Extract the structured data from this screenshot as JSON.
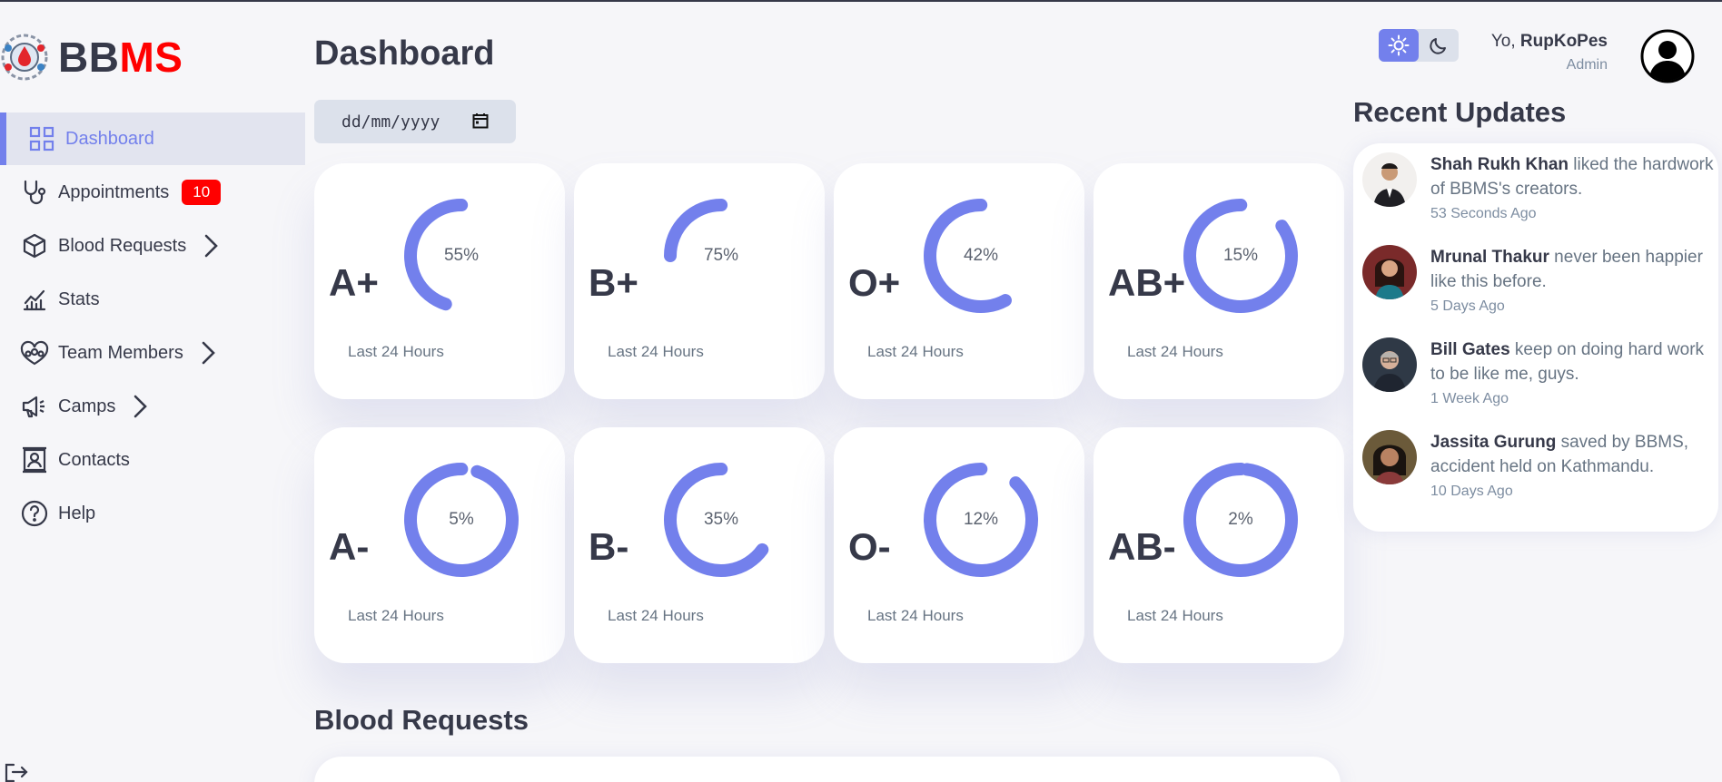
{
  "brand": {
    "part1": "BB",
    "part2": "MS"
  },
  "sidebar": {
    "items": [
      {
        "label": "Dashboard",
        "icon": "grid-icon"
      },
      {
        "label": "Appointments",
        "icon": "stethoscope-icon",
        "badge": "10"
      },
      {
        "label": "Blood Requests",
        "icon": "cube-icon",
        "chevron": true
      },
      {
        "label": "Stats",
        "icon": "chart-icon"
      },
      {
        "label": "Team Members",
        "icon": "team-icon",
        "chevron": true
      },
      {
        "label": "Camps",
        "icon": "megaphone-icon",
        "chevron": true
      },
      {
        "label": "Contacts",
        "icon": "contact-icon"
      },
      {
        "label": "Help",
        "icon": "help-icon"
      }
    ],
    "logout_icon": "logout-icon"
  },
  "main": {
    "title": "Dashboard",
    "date_placeholder": "dd/mm/yyyy",
    "cards": [
      {
        "type": "A+",
        "percent": 55,
        "percent_label": "55%",
        "sub": "Last 24 Hours"
      },
      {
        "type": "B+",
        "percent": 75,
        "percent_label": "75%",
        "sub": "Last 24 Hours"
      },
      {
        "type": "O+",
        "percent": 42,
        "percent_label": "42%",
        "sub": "Last 24 Hours"
      },
      {
        "type": "AB+",
        "percent": 15,
        "percent_label": "15%",
        "sub": "Last 24 Hours"
      },
      {
        "type": "A-",
        "percent": 5,
        "percent_label": "5%",
        "sub": "Last 24 Hours"
      },
      {
        "type": "B-",
        "percent": 35,
        "percent_label": "35%",
        "sub": "Last 24 Hours"
      },
      {
        "type": "O-",
        "percent": 12,
        "percent_label": "12%",
        "sub": "Last 24 Hours"
      },
      {
        "type": "AB-",
        "percent": 2,
        "percent_label": "2%",
        "sub": "Last 24 Hours"
      }
    ],
    "blood_requests_title": "Blood Requests"
  },
  "topbar": {
    "greeting": "Yo, ",
    "username": "RupKoPes",
    "role": "Admin"
  },
  "updates": {
    "title": "Recent Updates",
    "items": [
      {
        "name": "Shah Rukh Khan",
        "text": " liked the hardwork of BBMS's creators.",
        "ago": "53 Seconds Ago"
      },
      {
        "name": "Mrunal Thakur",
        "text": " never been happier like this before.",
        "ago": "5 Days Ago"
      },
      {
        "name": "Bill Gates",
        "text": " keep on doing hard work to be like me, guys.",
        "ago": "1 Week Ago"
      },
      {
        "name": "Jassita Gurung",
        "text": " saved by BBMS, accident held on Kathmandu.",
        "ago": "10 Days Ago"
      }
    ]
  },
  "colors": {
    "primary": "#7380ec",
    "danger": "#ff0000",
    "dark": "#363949",
    "background": "#f6f6f9"
  }
}
